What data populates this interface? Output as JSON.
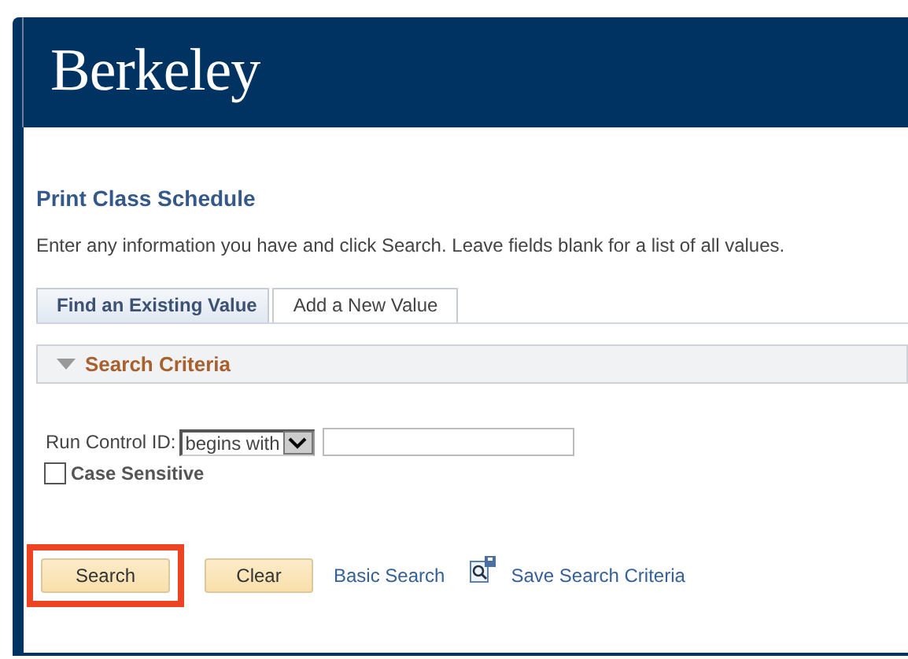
{
  "header": {
    "logo": "Berkeley"
  },
  "page_title": "Print Class Schedule",
  "instructions": "Enter any information you have and click Search. Leave fields blank for a list of all values.",
  "tabs": [
    {
      "label": "Find an Existing Value",
      "selected": true
    },
    {
      "label": "Add a New Value",
      "selected": false
    }
  ],
  "section": {
    "title": "Search Criteria",
    "expanded": true
  },
  "run_control": {
    "label": "Run Control ID:",
    "operator": "begins with"
  },
  "case_sensitive": {
    "label": "Case Sensitive",
    "checked": false
  },
  "buttons": [
    {
      "label": "Search",
      "highlighted": true
    },
    {
      "label": "Clear",
      "highlighted": false
    }
  ],
  "links": [
    {
      "label": "Basic Search",
      "kind": "link"
    },
    {
      "label": "Save Search Criteria",
      "kind": "icon-link"
    }
  ]
}
